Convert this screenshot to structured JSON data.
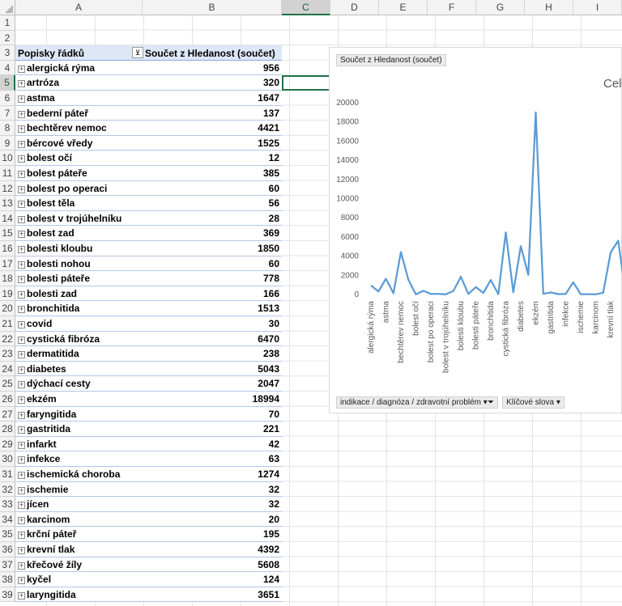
{
  "columns": [
    "A",
    "B",
    "C",
    "D",
    "E",
    "F",
    "G",
    "H",
    "I"
  ],
  "selected_column": "C",
  "rows": [
    "1",
    "2",
    "3",
    "4",
    "5",
    "6",
    "7",
    "8",
    "9",
    "10",
    "11",
    "12",
    "13",
    "14",
    "15",
    "16",
    "17",
    "18",
    "19",
    "20",
    "21",
    "22",
    "23",
    "24",
    "25",
    "26",
    "27",
    "28",
    "29",
    "30",
    "31",
    "32",
    "33",
    "34",
    "35",
    "36",
    "37",
    "38",
    "39"
  ],
  "selected_row": "5",
  "pivot": {
    "row_labels_header": "Popisky řádků",
    "value_header": "Součet z Hledanost (součet)",
    "filter_icon": "filter-dropdown-icon",
    "items": [
      {
        "label": "alergická rýma",
        "value": "956"
      },
      {
        "label": "artróza",
        "value": "320"
      },
      {
        "label": "astma",
        "value": "1647"
      },
      {
        "label": "bederní páteř",
        "value": "137"
      },
      {
        "label": "bechtěrev nemoc",
        "value": "4421"
      },
      {
        "label": "bércové vředy",
        "value": "1525"
      },
      {
        "label": "bolest očí",
        "value": "12"
      },
      {
        "label": "bolest páteře",
        "value": "385"
      },
      {
        "label": "bolest po operaci",
        "value": "60"
      },
      {
        "label": "bolest těla",
        "value": "56"
      },
      {
        "label": "bolest v trojúhelníku",
        "value": "28"
      },
      {
        "label": "bolest zad",
        "value": "369"
      },
      {
        "label": "bolesti kloubu",
        "value": "1850"
      },
      {
        "label": "bolesti nohou",
        "value": "60"
      },
      {
        "label": "bolesti páteře",
        "value": "778"
      },
      {
        "label": "bolesti zad",
        "value": "166"
      },
      {
        "label": "bronchitida",
        "value": "1513"
      },
      {
        "label": "covid",
        "value": "30"
      },
      {
        "label": "cystická fibróza",
        "value": "6470"
      },
      {
        "label": "dermatitida",
        "value": "238"
      },
      {
        "label": "diabetes",
        "value": "5043"
      },
      {
        "label": "dýchací cesty",
        "value": "2047"
      },
      {
        "label": "ekzém",
        "value": "18994"
      },
      {
        "label": "faryngitida",
        "value": "70"
      },
      {
        "label": "gastritida",
        "value": "221"
      },
      {
        "label": "infarkt",
        "value": "42"
      },
      {
        "label": "infekce",
        "value": "63"
      },
      {
        "label": "ischemická choroba",
        "value": "1274"
      },
      {
        "label": "ischemie",
        "value": "32"
      },
      {
        "label": "jícen",
        "value": "32"
      },
      {
        "label": "karcinom",
        "value": "20"
      },
      {
        "label": "krční páteř",
        "value": "195"
      },
      {
        "label": "krevní tlak",
        "value": "4392"
      },
      {
        "label": "křečové žíly",
        "value": "5608"
      },
      {
        "label": "kyčel",
        "value": "124"
      },
      {
        "label": "laryngitida",
        "value": "3651"
      }
    ]
  },
  "chart": {
    "field_button_top": "Součet z Hledanost (součet)",
    "title_partial": "Cel",
    "field_button_axis": "indikace / diagnóza / zdravotní problém",
    "field_button_axis2": "Klíčové slova",
    "line_color": "#5b9bd5"
  },
  "chart_data": {
    "type": "line",
    "ylim": [
      0,
      20000
    ],
    "yticks": [
      "0",
      "2000",
      "4000",
      "6000",
      "8000",
      "10000",
      "12000",
      "14000",
      "16000",
      "18000",
      "20000"
    ],
    "x": [
      "alergická rýma",
      "artróza",
      "astma",
      "bederní páteř",
      "bechtěrev nemoc",
      "bércové vředy",
      "bolest očí",
      "bolest páteře",
      "bolest po operaci",
      "bolest těla",
      "bolest v trojúhelníku",
      "bolest zad",
      "bolesti kloubu",
      "bolesti nohou",
      "bolesti páteře",
      "bolesti zad",
      "bronchitida",
      "covid",
      "cystická fibróza",
      "dermatitida",
      "diabetes",
      "dýchací cesty",
      "ekzém",
      "faryngitida",
      "gastritida",
      "infarkt",
      "infekce",
      "ischemická choroba",
      "ischemie",
      "jícen",
      "karcinom",
      "krční páteř",
      "krevní tlak",
      "křečové žíly",
      "kyčel"
    ],
    "tick_labels": [
      "alergická rýma",
      "astma",
      "bechtěrev nemoc",
      "bolest očí",
      "bolest po operaci",
      "bolest v trojúhelníku",
      "bolesti kloubu",
      "bolesti páteře",
      "bronchitida",
      "cystická fibróza",
      "diabetes",
      "ekzém",
      "gastritida",
      "infekce",
      "ischemie",
      "karcinom",
      "krevní tlak"
    ],
    "values": [
      956,
      320,
      1647,
      137,
      4421,
      1525,
      12,
      385,
      60,
      56,
      28,
      369,
      1850,
      60,
      778,
      166,
      1513,
      30,
      6470,
      238,
      5043,
      2047,
      18994,
      70,
      221,
      42,
      63,
      1274,
      32,
      32,
      20,
      195,
      4392,
      5608,
      124
    ]
  }
}
